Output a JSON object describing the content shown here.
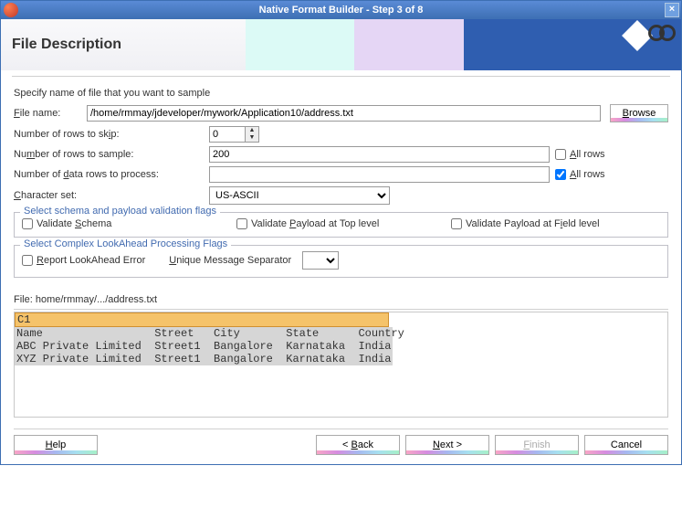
{
  "window": {
    "title": "Native Format Builder - Step 3 of 8",
    "close_icon": "×"
  },
  "header": {
    "page_title": "File Description"
  },
  "instructions": "Specify name of file that you want to sample",
  "form": {
    "file_name_label": "File name:",
    "file_name_value": "/home/rmmay/jdeveloper/mywork/Application10/address.txt",
    "browse_label": "Browse",
    "rows_skip_label": "Number of rows to skip:",
    "rows_skip_value": "0",
    "rows_sample_label": "Number of rows to sample:",
    "rows_sample_value": "200",
    "data_rows_label": "Number of data rows to process:",
    "data_rows_value": "",
    "all_rows_label": "All rows",
    "charset_label": "Character set:",
    "charset_value": "US-ASCII"
  },
  "validation_fieldset": {
    "legend": "Select schema and payload validation flags",
    "validate_schema": "Validate Schema",
    "validate_top": "Validate Payload at Top level",
    "validate_field": "Validate Payload at Field level"
  },
  "lookahead_fieldset": {
    "legend": "Select Complex LookAhead Processing Flags",
    "report_error": "Report LookAhead Error",
    "separator_label": "Unique Message Separator"
  },
  "preview": {
    "file_label": "File: home/rmmay/.../address.txt",
    "selected_line": "C1",
    "lines": [
      "Name                 Street   City       State      Country",
      "ABC Private Limited  Street1  Bangalore  Karnataka  India",
      "XYZ Private Limited  Street1  Bangalore  Karnataka  India"
    ]
  },
  "footer": {
    "help": "Help",
    "back": "< Back",
    "next": "Next >",
    "finish": "Finish",
    "cancel": "Cancel"
  }
}
